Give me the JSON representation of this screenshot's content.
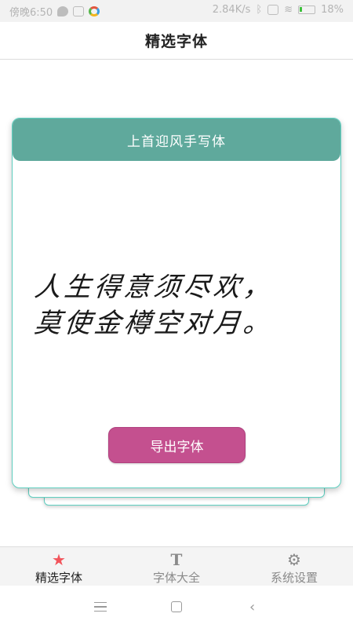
{
  "status_bar": {
    "time": "傍晚6:50",
    "speed": "2.84K/s",
    "battery": "18%"
  },
  "header": {
    "title": "精选字体"
  },
  "card": {
    "font_name": "上首迎风手写体",
    "preview_lines": [
      "人生得意须尽欢，",
      "莫使金樽空对月。"
    ],
    "export_label": "导出字体"
  },
  "tabs": [
    {
      "label": "精选字体",
      "icon": "star-icon",
      "active": true
    },
    {
      "label": "字体大全",
      "icon": "text-t-icon",
      "active": false
    },
    {
      "label": "系统设置",
      "icon": "gear-icon",
      "active": false
    }
  ],
  "colors": {
    "card_header": "#5fa99c",
    "card_border": "#5fcfc0",
    "export_button": "#c4508f",
    "active_tab_icon": "#f2545b"
  }
}
